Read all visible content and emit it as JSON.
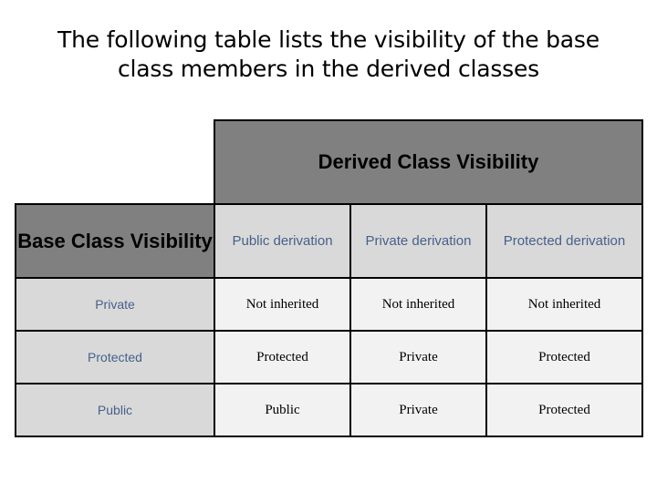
{
  "slide": {
    "title": "The following table lists the visibility of the base class members in the derived classes"
  },
  "table": {
    "corner_label": "",
    "banner_header": "Derived Class Visibility",
    "stub_header": "Base Class Visibility",
    "column_headers": [
      "Public derivation",
      "Private derivation",
      "Protected derivation"
    ],
    "rows": [
      {
        "label": "Private",
        "cells": [
          "Not inherited",
          "Not inherited",
          "Not inherited"
        ]
      },
      {
        "label": "Protected",
        "cells": [
          "Protected",
          "Private",
          "Protected"
        ]
      },
      {
        "label": "Public",
        "cells": [
          "Public",
          "Private",
          "Protected"
        ]
      }
    ]
  },
  "colors": {
    "banner_bg": "#808080",
    "stub_bg": "#808080",
    "header_bg": "#d9d9d9",
    "body_bg": "#f2f2f2",
    "label_text": "#46618a",
    "border": "#000000",
    "page_bg": "#ffffff"
  }
}
